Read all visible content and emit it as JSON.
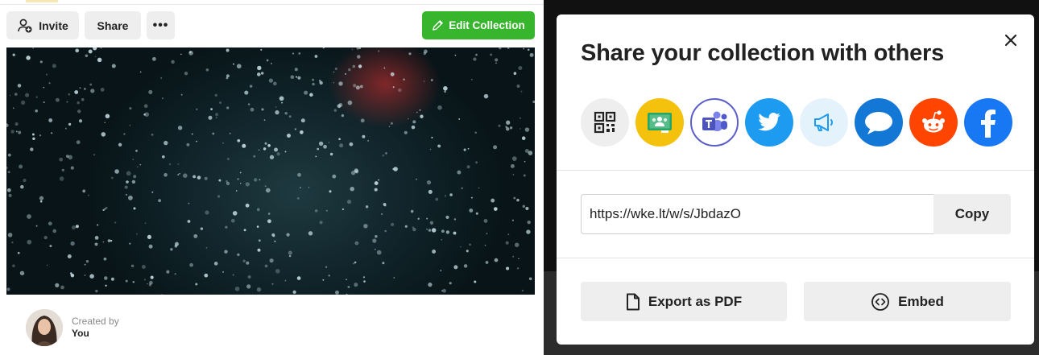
{
  "toolbar": {
    "invite_label": "Invite",
    "share_label": "Share",
    "more_label": "•••",
    "edit_label": "Edit Collection"
  },
  "creator": {
    "label": "Created by",
    "name": "You"
  },
  "modal": {
    "title": "Share your collection with others",
    "share_targets": [
      {
        "name": "qr-code",
        "icon": "qr-code-icon"
      },
      {
        "name": "google-classroom",
        "icon": "google-classroom-icon"
      },
      {
        "name": "microsoft-teams",
        "icon": "microsoft-teams-icon"
      },
      {
        "name": "twitter",
        "icon": "twitter-icon"
      },
      {
        "name": "announce",
        "icon": "megaphone-icon"
      },
      {
        "name": "chat",
        "icon": "chat-bubble-icon"
      },
      {
        "name": "reddit",
        "icon": "reddit-icon"
      },
      {
        "name": "facebook",
        "icon": "facebook-icon"
      }
    ],
    "link_value": "https://wke.lt/w/s/JbdazO",
    "copy_label": "Copy",
    "export_pdf_label": "Export as PDF",
    "embed_label": "Embed"
  },
  "colors": {
    "edit_button": "#36b52d",
    "twitter": "#1d9bf0",
    "reddit": "#ff4500",
    "facebook": "#1877f2",
    "classroom": "#f4c20d",
    "teams": "#5b5fc7"
  }
}
